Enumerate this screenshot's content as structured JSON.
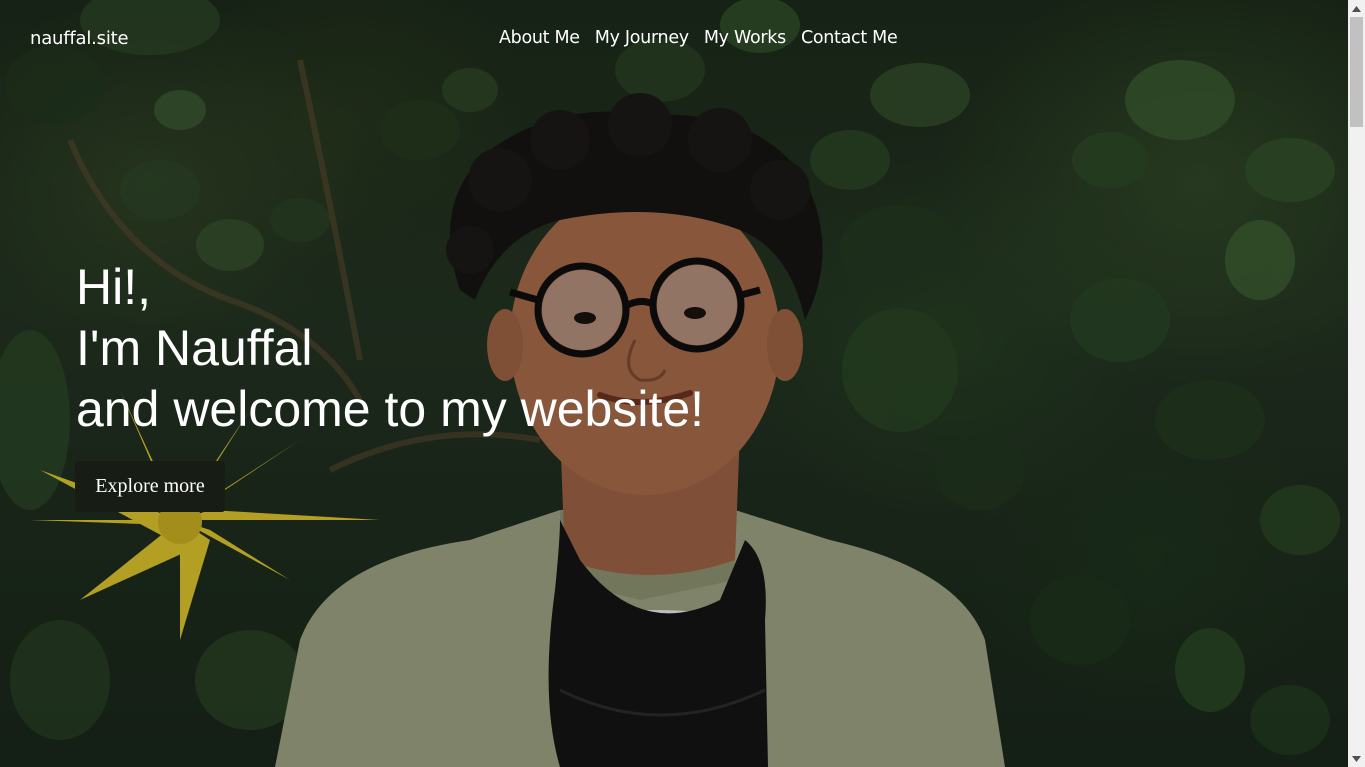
{
  "site": {
    "brand": "nauffal.site"
  },
  "nav": {
    "items": [
      {
        "label": "About Me"
      },
      {
        "label": "My Journey"
      },
      {
        "label": "My Works"
      },
      {
        "label": "Contact Me"
      }
    ]
  },
  "hero": {
    "line1": "Hi!,",
    "line2": "I'm Nauffal",
    "line3": "and welcome to my website!",
    "cta_label": "Explore more",
    "photo_icon": "portrait-photo",
    "colors": {
      "cta_background": "#171c15",
      "text": "#ffffff",
      "foliage": "#2f4a2a",
      "flower": "#d9c22c",
      "shirt": "#9aa080"
    }
  },
  "scrollbar": {
    "up_icon": "triangle-up-icon",
    "down_icon": "triangle-down-icon"
  }
}
